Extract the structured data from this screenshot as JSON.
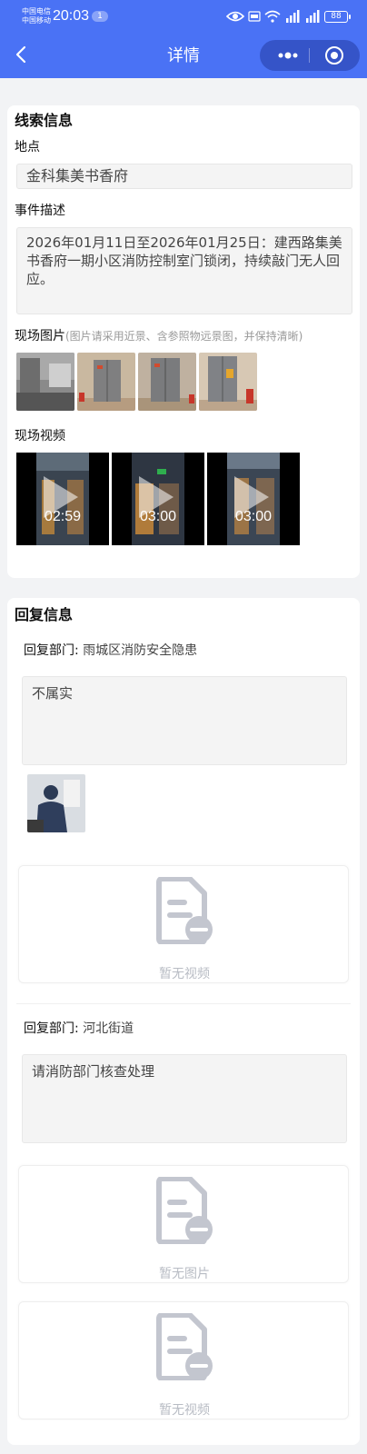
{
  "status_bar": {
    "carrier1": "中国电信",
    "carrier2": "中国移动",
    "time": "20:03",
    "notifications": "1",
    "battery": "88"
  },
  "nav": {
    "title": "详情"
  },
  "clue": {
    "section_title": "线索信息",
    "location_label": "地点",
    "location_value": "金科集美书香府",
    "desc_label": "事件描述",
    "desc_value": "2026年01月11日至2026年01月25日：建西路集美书香府一期小区消防控制室门锁闭，持续敲门无人回应。",
    "photos_label": "现场图片",
    "photos_hint": "(图片请采用近景、含参照物远景图，并保持清晰)",
    "videos_label": "现场视频",
    "videos": [
      {
        "duration": "02:59"
      },
      {
        "duration": "03:00"
      },
      {
        "duration": "03:00"
      }
    ]
  },
  "reply": {
    "section_title": "回复信息",
    "items": [
      {
        "dept_label": "回复部门:",
        "dept_value": "雨城区消防安全隐患",
        "content": "不属实",
        "video_empty": "暂无视频"
      },
      {
        "dept_label": "回复部门:",
        "dept_value": "河北街道",
        "content": "请消防部门核查处理",
        "image_empty": "暂无图片",
        "video_empty": "暂无视频"
      }
    ]
  },
  "colors": {
    "header": "#4a72f5",
    "capsule": "#3554c8",
    "empty_icon": "#c3c6cf"
  }
}
